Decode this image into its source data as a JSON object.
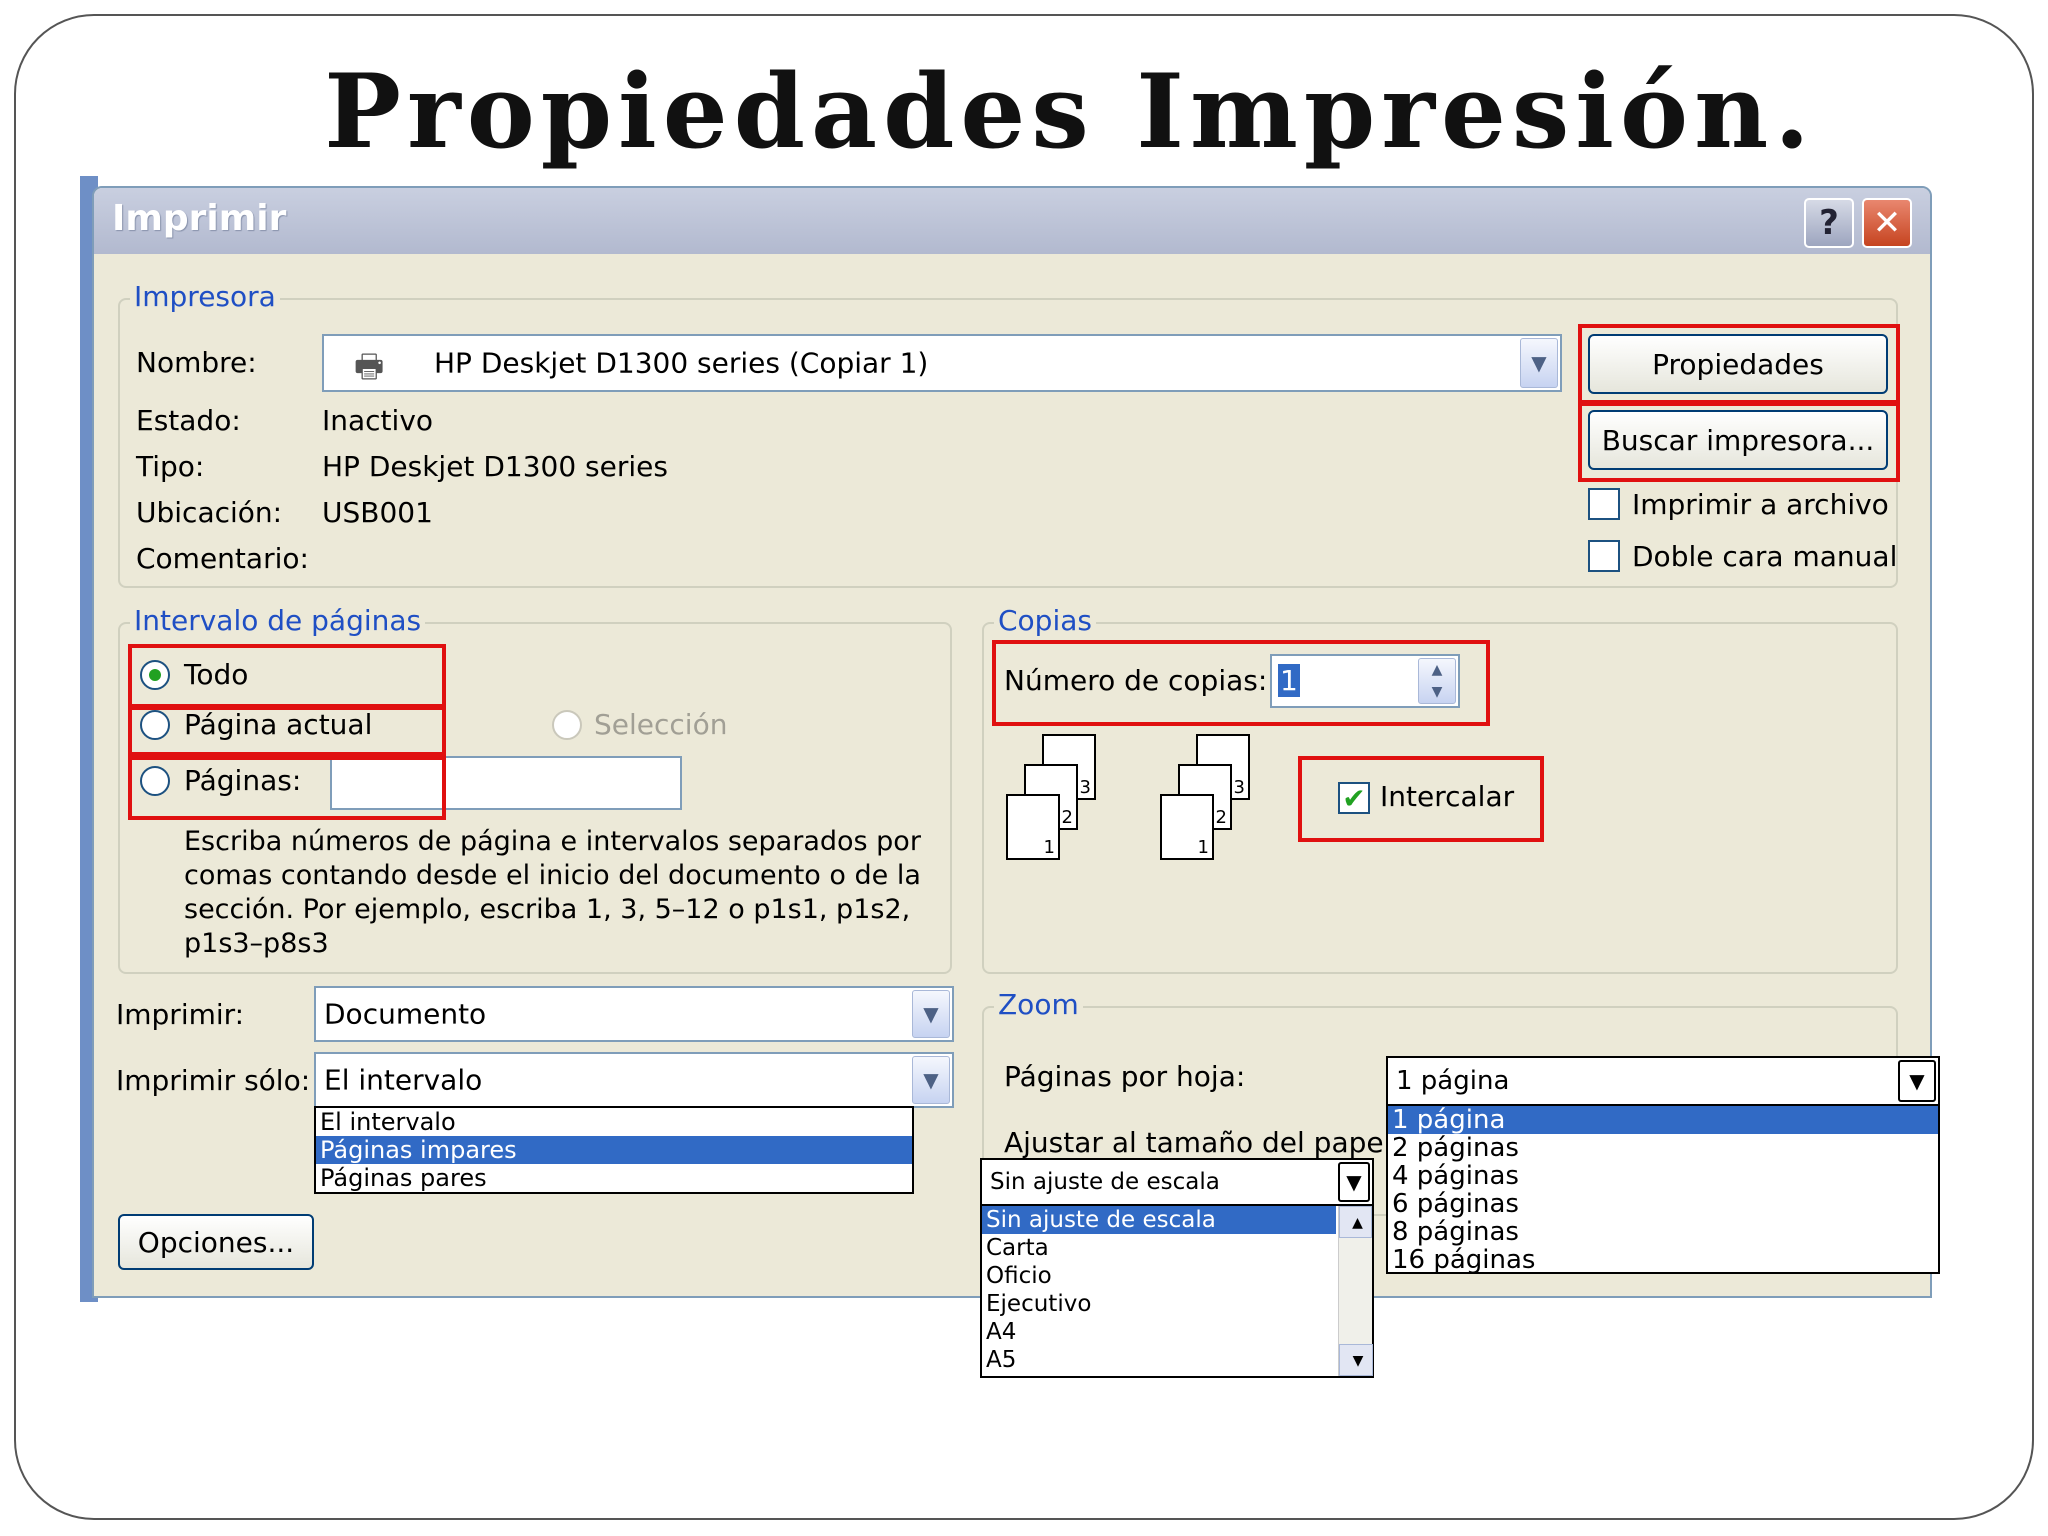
{
  "slide": {
    "title": "Propiedades Impresión."
  },
  "dialog": {
    "title": "Imprimir",
    "help_button": "?",
    "close_button": "✕",
    "printer_group": {
      "legend": "Impresora",
      "name_label": "Nombre:",
      "name_value": "HP Deskjet D1300 series (Copiar 1)",
      "status_label": "Estado:",
      "status_value": "Inactivo",
      "type_label": "Tipo:",
      "type_value": "HP Deskjet D1300 series",
      "location_label": "Ubicación:",
      "location_value": "USB001",
      "comment_label": "Comentario:",
      "properties_button": "Propiedades",
      "find_printer_button": "Buscar impresora...",
      "print_to_file": "Imprimir a archivo",
      "manual_duplex": "Doble cara manual"
    },
    "page_range": {
      "legend": "Intervalo de páginas",
      "all": "Todo",
      "current_page": "Página actual",
      "selection": "Selección",
      "pages": "Páginas:",
      "help_text_1": "Escriba números de página e intervalos separados por",
      "help_text_2": "comas contando desde el inicio del documento o de la",
      "help_text_3": "sección. Por ejemplo, escriba 1, 3, 5–12 o p1s1, p1s2,",
      "help_text_4": "p1s3–p8s3"
    },
    "copies": {
      "legend": "Copias",
      "number_label": "Número de copias:",
      "number_value": "1",
      "collate": "Intercalar",
      "collate_checked": true,
      "stack_pages": [
        "1",
        "2",
        "3"
      ]
    },
    "print_what": {
      "label": "Imprimir:",
      "value": "Documento"
    },
    "print_only": {
      "label": "Imprimir sólo:",
      "value": "El intervalo",
      "options": [
        "El intervalo",
        "Páginas impares",
        "Páginas pares"
      ],
      "highlighted": "Páginas impares"
    },
    "zoom": {
      "legend": "Zoom",
      "pages_per_sheet_label": "Páginas por hoja:",
      "pages_per_sheet_value": "1 página",
      "pages_per_sheet_options": [
        "1 página",
        "2 páginas",
        "4 páginas",
        "6 páginas",
        "8 páginas",
        "16 páginas"
      ],
      "scale_label": "Ajustar al tamaño del papel:",
      "scale_value": "Sin ajuste de escala",
      "scale_options": [
        "Sin ajuste de escala",
        "Carta",
        "Oficio",
        "Ejecutivo",
        "A4",
        "A5"
      ]
    },
    "options_button": "Opciones..."
  },
  "colors": {
    "dialog_bg": "#ece9d8",
    "legend_blue": "#1f4fc4",
    "highlight": "#316ac5",
    "annotation_red": "#e01010"
  }
}
